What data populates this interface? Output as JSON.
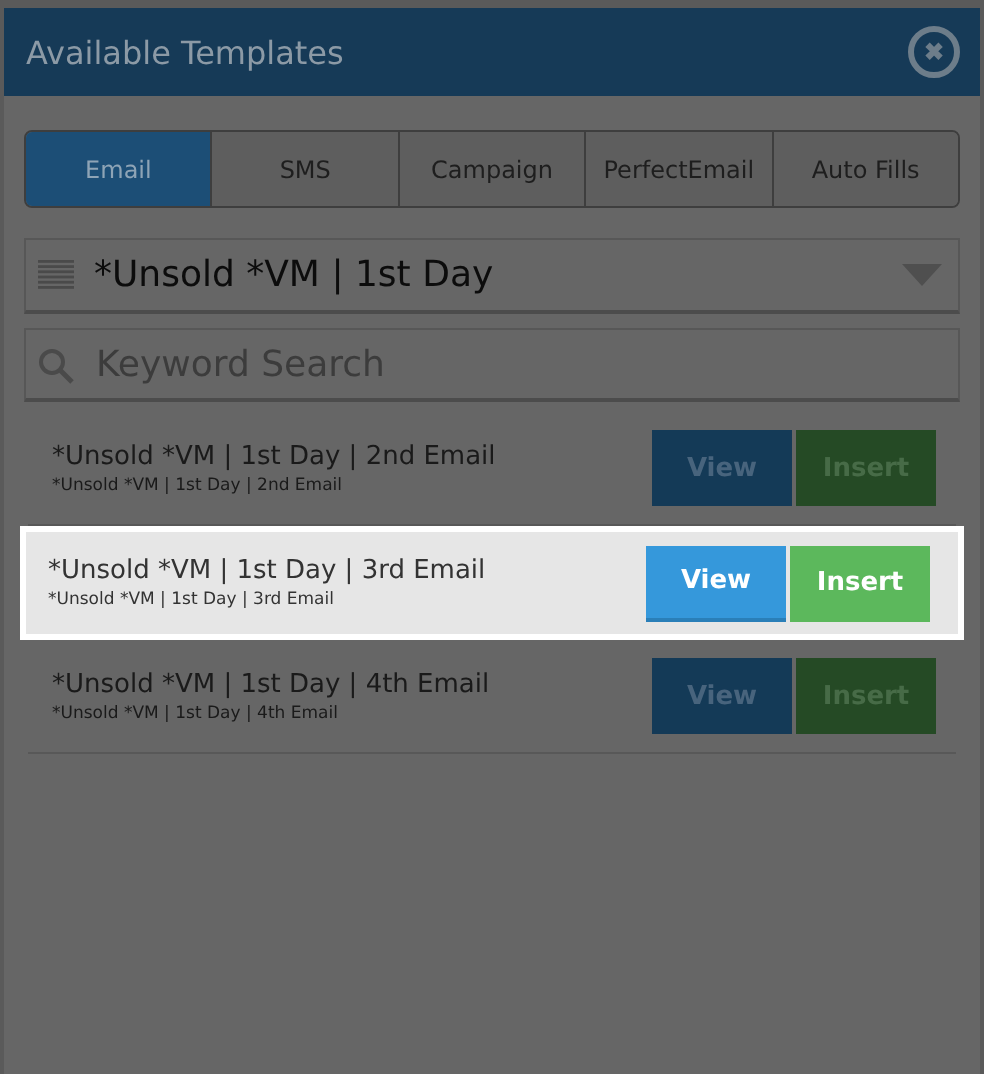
{
  "window": {
    "title": "Available Templates",
    "close": "✖"
  },
  "tabs": [
    {
      "label": "Email",
      "selected": true
    },
    {
      "label": "SMS",
      "selected": false
    },
    {
      "label": "Campaign",
      "selected": false
    },
    {
      "label": "PerfectEmail",
      "selected": false
    },
    {
      "label": "Auto Fills",
      "selected": false
    }
  ],
  "dropdown": {
    "value": "*Unsold *VM | 1st Day"
  },
  "search": {
    "placeholder": "Keyword Search"
  },
  "templates": [
    {
      "title": "*Unsold *VM | 1st Day | 2nd Email",
      "subtitle": "*Unsold *VM | 1st Day | 2nd Email",
      "highlighted": false,
      "view": "View",
      "insert": "Insert"
    },
    {
      "title": "*Unsold *VM | 1st Day | 3rd Email",
      "subtitle": "*Unsold *VM | 1st Day | 3rd Email",
      "highlighted": true,
      "view": "View",
      "insert": "Insert"
    },
    {
      "title": "*Unsold *VM | 1st Day | 4th Email",
      "subtitle": "*Unsold *VM | 1st Day | 4th Email",
      "highlighted": false,
      "view": "View",
      "insert": "Insert"
    }
  ]
}
